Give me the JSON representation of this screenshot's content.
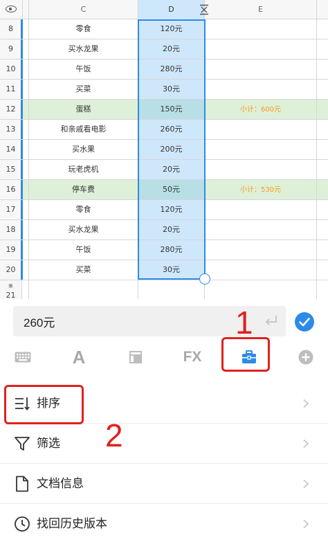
{
  "sheet": {
    "columns": {
      "C": "C",
      "D": "D",
      "E": "E"
    },
    "rows": [
      {
        "num": "8",
        "item": "零食",
        "amount": "120元",
        "note": ""
      },
      {
        "num": "9",
        "item": "买水龙果",
        "amount": "20元",
        "note": ""
      },
      {
        "num": "10",
        "item": "午饭",
        "amount": "280元",
        "note": ""
      },
      {
        "num": "11",
        "item": "买菜",
        "amount": "30元",
        "note": ""
      },
      {
        "num": "12",
        "item": "蛋糕",
        "amount": "150元",
        "note": "小计：600元"
      },
      {
        "num": "13",
        "item": "和亲戚看电影",
        "amount": "260元",
        "note": ""
      },
      {
        "num": "14",
        "item": "买水果",
        "amount": "200元",
        "note": ""
      },
      {
        "num": "15",
        "item": "玩老虎机",
        "amount": "20元",
        "note": ""
      },
      {
        "num": "16",
        "item": "停车费",
        "amount": "50元",
        "note": "小计：530元"
      },
      {
        "num": "17",
        "item": "零食",
        "amount": "120元",
        "note": ""
      },
      {
        "num": "18",
        "item": "买水龙果",
        "amount": "20元",
        "note": ""
      },
      {
        "num": "19",
        "item": "午饭",
        "amount": "280元",
        "note": ""
      },
      {
        "num": "20",
        "item": "买菜",
        "amount": "30元",
        "note": ""
      }
    ],
    "last_row": {
      "marker": "⋇",
      "num": "21"
    }
  },
  "formula_bar": {
    "value": "260元"
  },
  "toolbar": {
    "text_icon_label": "A",
    "fx_label": "FX"
  },
  "menu": {
    "items": [
      {
        "label": "排序",
        "icon": "sort-icon"
      },
      {
        "label": "筛选",
        "icon": "filter-icon"
      },
      {
        "label": "文档信息",
        "icon": "document-icon"
      },
      {
        "label": "找回历史版本",
        "icon": "history-icon"
      }
    ]
  },
  "annotations": {
    "step1": "1",
    "step2": "2"
  },
  "colors": {
    "accent": "#2c8be6",
    "selected_column": "#cfe7fb",
    "highlight_row": "#dff0d8",
    "note_text": "#f29b1d",
    "annotation_red": "#e02020"
  }
}
